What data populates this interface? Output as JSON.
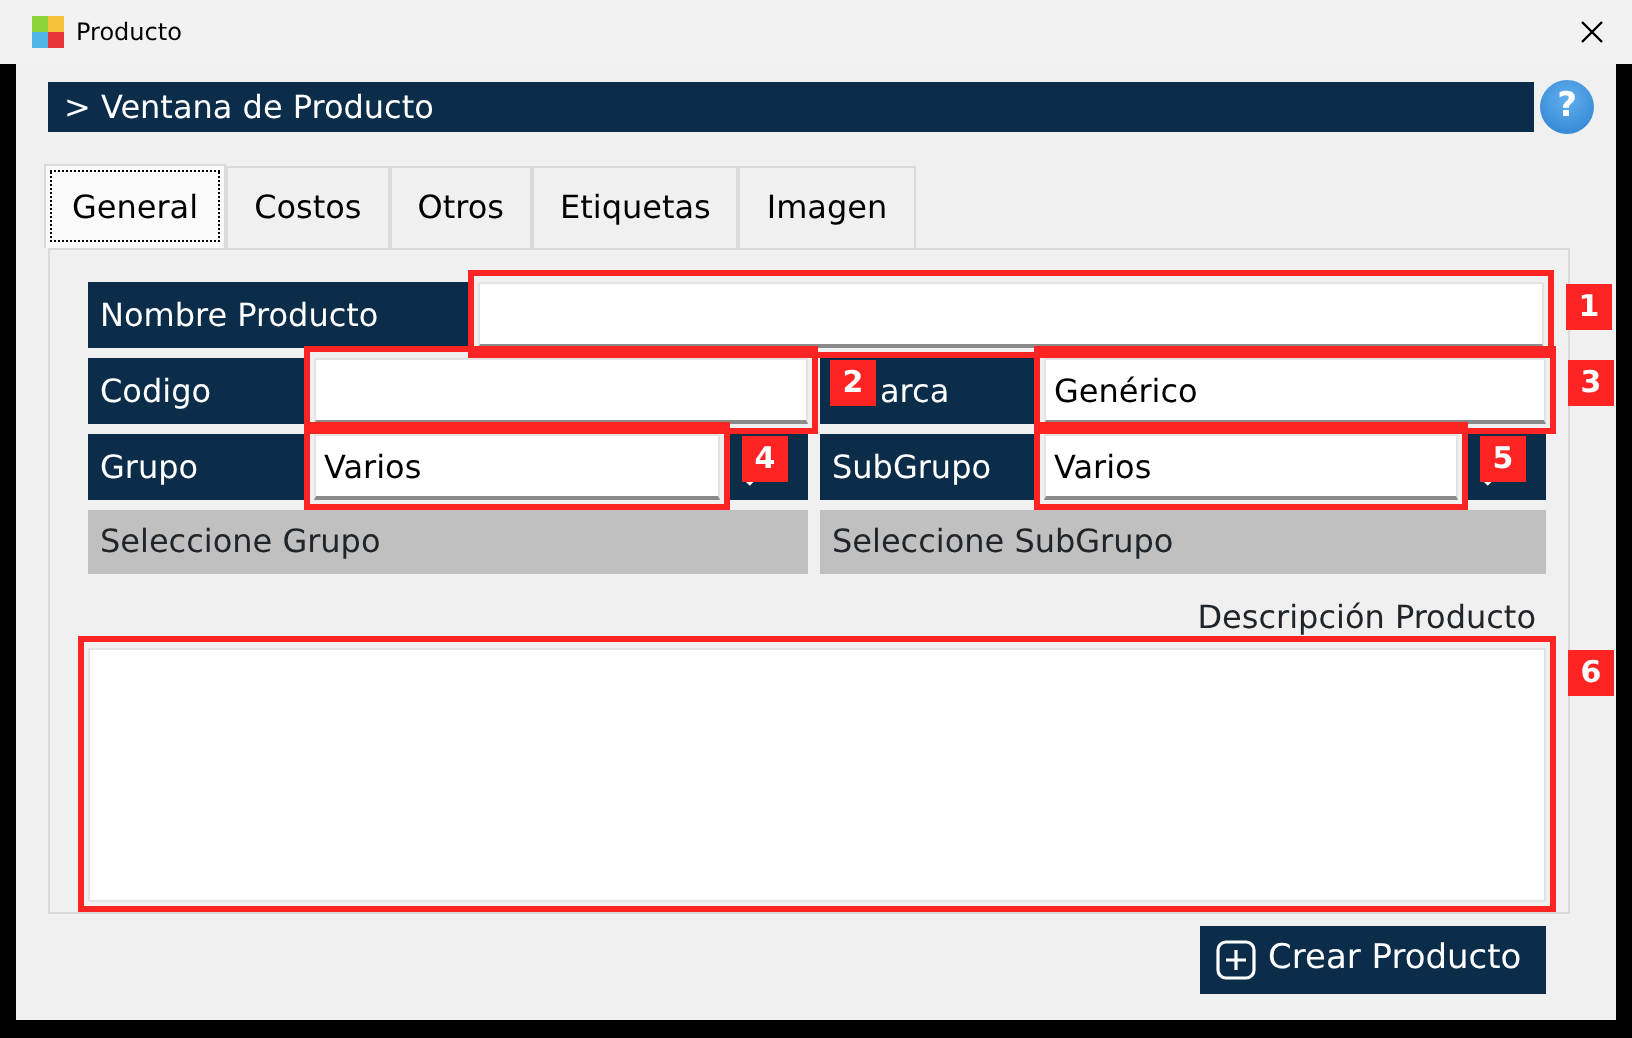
{
  "window": {
    "title": "Producto"
  },
  "header": {
    "title": "> Ventana de Producto",
    "help": "?"
  },
  "tabs": [
    {
      "label": "General",
      "selected": true
    },
    {
      "label": "Costos",
      "selected": false
    },
    {
      "label": "Otros",
      "selected": false
    },
    {
      "label": "Etiquetas",
      "selected": false
    },
    {
      "label": "Imagen",
      "selected": false
    }
  ],
  "rows": [
    [
      {
        "kind": "text",
        "label": "Nombre Producto",
        "annotation": "1"
      }
    ],
    [
      {
        "kind": "text",
        "label": "Codigo",
        "annotation": "2"
      },
      {
        "kind": "text",
        "label": "arca",
        "value": "Genérico",
        "annotation": "3"
      }
    ],
    [
      {
        "kind": "lookup",
        "label": "Grupo",
        "value": "Varios",
        "annotation": "4"
      },
      {
        "kind": "lookup",
        "label": "SubGrupo",
        "value": "Varios",
        "annotation": "5"
      }
    ]
  ],
  "selectors": [
    {
      "text": "Seleccione Grupo"
    },
    {
      "text": "Seleccione SubGrupo"
    }
  ],
  "description": {
    "label": "Descripción Producto",
    "annotation": "6"
  },
  "button": {
    "label": "Crear Producto"
  }
}
